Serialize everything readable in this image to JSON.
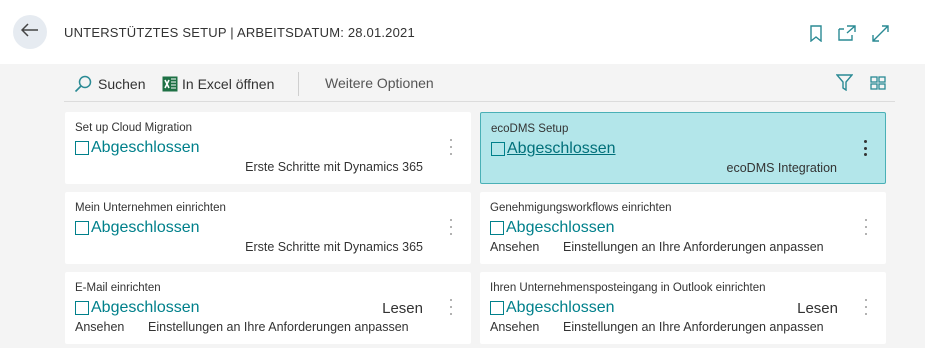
{
  "header": {
    "title": "UNTERSTÜTZTES SETUP | ARBEITSDATUM: 28.01.2021"
  },
  "actions": {
    "search": "Suchen",
    "excel": "In Excel öffnen",
    "more": "Weitere Optionen"
  },
  "tiles": [
    {
      "title": "Set up Cloud Migration",
      "status": "Abgeschlossen",
      "category": "Erste Schritte mit Dynamics 365",
      "read": "",
      "left": "",
      "desc": ""
    },
    {
      "title": "ecoDMS Setup",
      "status": "Abgeschlossen",
      "category": "ecoDMS Integration",
      "read": "",
      "left": "",
      "desc": ""
    },
    {
      "title": "Mein Unternehmen einrichten",
      "status": "Abgeschlossen",
      "category": "Erste Schritte mit Dynamics 365",
      "read": "",
      "left": "",
      "desc": ""
    },
    {
      "title": "Genehmigungsworkflows einrichten",
      "status": "Abgeschlossen",
      "category": "",
      "read": "",
      "left": "Ansehen",
      "desc": "Einstellungen an Ihre Anforderungen anpassen"
    },
    {
      "title": "E-Mail einrichten",
      "status": "Abgeschlossen",
      "category": "",
      "read": "Lesen",
      "left": "Ansehen",
      "desc": "Einstellungen an Ihre Anforderungen anpassen"
    },
    {
      "title": "Ihren Unternehmensposteingang in Outlook einrichten",
      "status": "Abgeschlossen",
      "category": "",
      "read": "Lesen",
      "left": "Ansehen",
      "desc": "Einstellungen an Ihre Anforderungen anpassen"
    }
  ],
  "colors": {
    "accent": "#00808b",
    "selected_bg": "#b3e6ea"
  },
  "icons": [
    "back-arrow-icon",
    "bookmark-icon",
    "open-new-window-icon",
    "expand-icon",
    "search-icon",
    "excel-icon",
    "filter-icon",
    "layout-icon",
    "more-options-icon"
  ]
}
